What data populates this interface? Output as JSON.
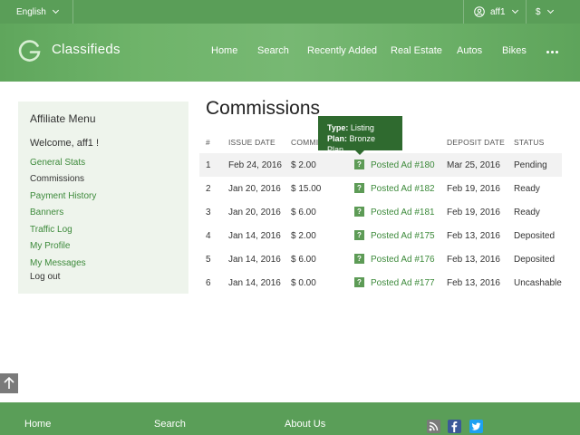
{
  "topbar": {
    "language": "English",
    "user": "aff1",
    "currency": "$"
  },
  "header": {
    "brand": "Classifieds",
    "nav": [
      "Home",
      "Search",
      "Recently Added",
      "Real Estate",
      "Autos",
      "Bikes"
    ]
  },
  "sidebar": {
    "title": "Affiliate Menu",
    "welcome": "Welcome, aff1 !",
    "items": [
      "General Stats",
      "Commissions",
      "Payment History",
      "Banners",
      "Traffic Log",
      "My Profile",
      "My Messages",
      "Log out"
    ]
  },
  "main": {
    "title": "Commissions",
    "columns": [
      "#",
      "ISSUE DATE",
      "COMMI",
      "DEPOSIT DATE",
      "STATUS"
    ],
    "rows": [
      {
        "n": "1",
        "issue": "Feb 24, 2016",
        "amount": "$ 2.00",
        "item": "Posted Ad #180",
        "deposit": "Mar 25, 2016",
        "status": "Pending"
      },
      {
        "n": "2",
        "issue": "Jan 20, 2016",
        "amount": "$ 15.00",
        "item": "Posted Ad #182",
        "deposit": "Feb 19, 2016",
        "status": "Ready"
      },
      {
        "n": "3",
        "issue": "Jan 20, 2016",
        "amount": "$ 6.00",
        "item": "Posted Ad #181",
        "deposit": "Feb 19, 2016",
        "status": "Ready"
      },
      {
        "n": "4",
        "issue": "Jan 14, 2016",
        "amount": "$ 2.00",
        "item": "Posted Ad #175",
        "deposit": "Feb 13, 2016",
        "status": "Deposited"
      },
      {
        "n": "5",
        "issue": "Jan 14, 2016",
        "amount": "$ 6.00",
        "item": "Posted Ad #176",
        "deposit": "Feb 13, 2016",
        "status": "Deposited"
      },
      {
        "n": "6",
        "issue": "Jan 14, 2016",
        "amount": "$ 0.00",
        "item": "Posted Ad #177",
        "deposit": "Feb 13, 2016",
        "status": "Uncashable"
      }
    ],
    "help_glyph": "?",
    "tooltip": {
      "type_label": "Type:",
      "type_value": "Listing",
      "plan_label": "Plan:",
      "plan_value": "Bronze Plan"
    }
  },
  "footer": {
    "links": [
      "Home",
      "Search",
      "About Us"
    ],
    "social_icons": [
      "rss-icon",
      "facebook-icon",
      "twitter-icon"
    ]
  },
  "colors": {
    "brand_green": "#5a9e58",
    "link_green": "#3d8a3b",
    "tooltip_bg": "#2f6a2f",
    "facebook": "#3b5998",
    "twitter": "#1da1f2"
  }
}
